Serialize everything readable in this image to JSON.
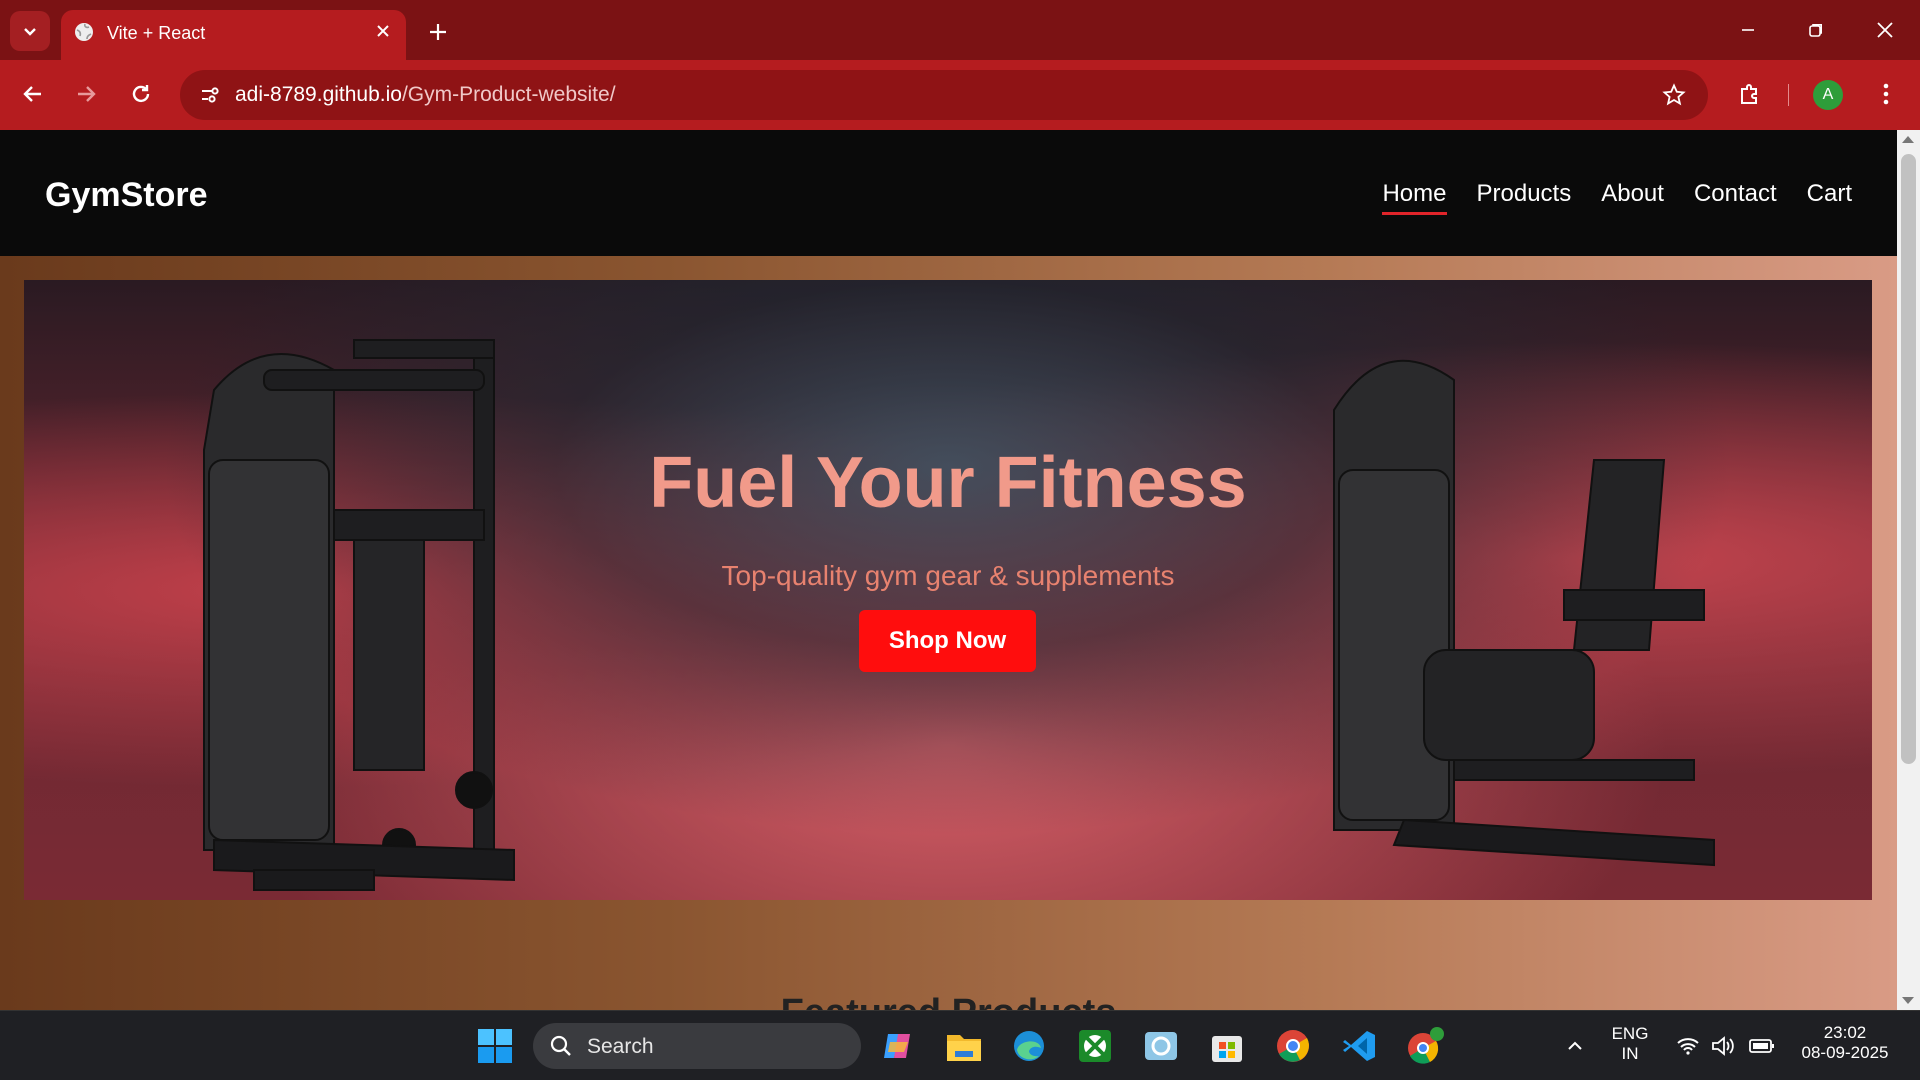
{
  "browser": {
    "tab_title": "Vite + React",
    "url_host": "adi-8789.github.io",
    "url_path": "/Gym-Product-website/",
    "profile_initial": "A"
  },
  "site": {
    "brand": "GymStore",
    "nav": [
      "Home",
      "Products",
      "About",
      "Contact",
      "Cart"
    ],
    "active_nav": "Home",
    "hero_title": "Fuel Your Fitness",
    "hero_subtitle": "Top-quality gym gear & supplements",
    "cta_label": "Shop Now",
    "featured_heading": "Featured Products"
  },
  "taskbar": {
    "search_label": "Search",
    "lang_line1": "ENG",
    "lang_line2": "IN",
    "time": "23:02",
    "date": "08-09-2025"
  },
  "colors": {
    "chrome": "#b51c1f",
    "cta": "#ff0d0d",
    "hero_text": "#f19a8a"
  }
}
